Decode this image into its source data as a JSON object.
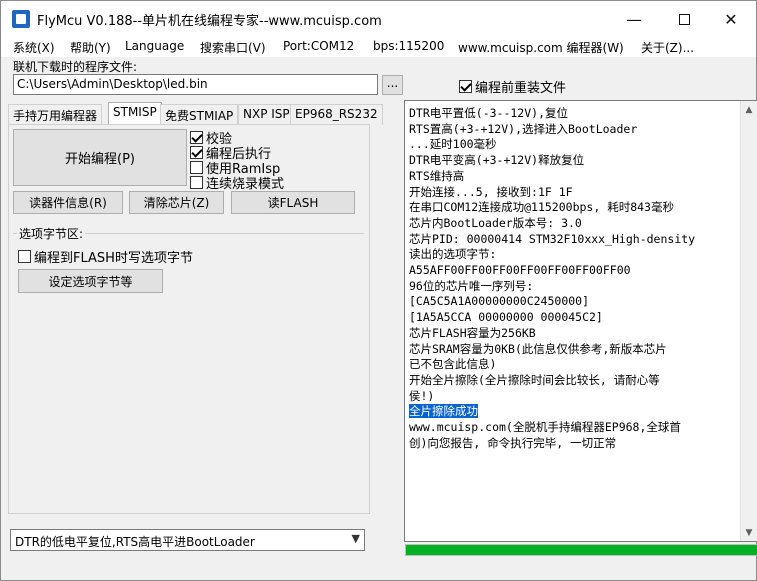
{
  "window": {
    "title": "FlyMcu V0.188--单片机在线编程专家--www.mcuisp.com",
    "minimize_glyph": "—",
    "close_glyph": "✕"
  },
  "menu": {
    "items": [
      "系统(X)",
      "帮助(Y)",
      "Language",
      "搜索串口(V)",
      "Port:COM12",
      "bps:115200",
      "www.mcuisp.com 编程器(W)",
      "关于(Z)..."
    ]
  },
  "file": {
    "label": "联机下载时的程序文件:",
    "path": "C:\\Users\\Admin\\Desktop\\led.bin",
    "browse_label": "...",
    "reload_label": "编程前重装文件",
    "reload_checked": true
  },
  "tabs": [
    "手持万用编程器",
    "STMISP",
    "免费STMIAP",
    "NXP ISP",
    "EP968_RS232"
  ],
  "active_tab": 1,
  "stmisp": {
    "start_label": "开始编程(P)",
    "options": [
      {
        "label": "校验",
        "checked": true
      },
      {
        "label": "编程后执行",
        "checked": true
      },
      {
        "label": "使用RamIsp",
        "checked": false
      },
      {
        "label": "连续烧录模式",
        "checked": false
      }
    ],
    "read_info_label": "读器件信息(R)",
    "erase_label": "清除芯片(Z)",
    "read_flash_label": "读FLASH",
    "option_group_title": "选项字节区:",
    "flash_opt_label": "编程到FLASH时写选项字节",
    "flash_opt_checked": false,
    "set_opt_label": "设定选项字节等"
  },
  "mode_select": {
    "value": "DTR的低电平复位,RTS高电平进BootLoader"
  },
  "log": {
    "lines": [
      "DTR电平置低(-3--12V),复位",
      "RTS置高(+3-+12V),选择进入BootLoader",
      "...延时100毫秒",
      "DTR电平变高(+3-+12V)释放复位",
      "RTS维持高",
      "开始连接...5, 接收到:1F 1F",
      "在串口COM12连接成功@115200bps, 耗时843毫秒",
      "芯片内BootLoader版本号: 3.0",
      "芯片PID: 00000414  STM32F10xxx_High-density",
      "读出的选项字节:",
      "A55AFF00FF00FF00FF00FF00FF00FF00",
      "96位的芯片唯一序列号:",
      "[CA5C5A1A00000000C2450000]",
      "[1A5A5CCA 00000000 000045C2]",
      "芯片FLASH容量为256KB",
      "芯片SRAM容量为0KB(此信息仅供参考,新版本芯片",
      "已不包含此信息)",
      "开始全片擦除(全片擦除时间会比较长, 请耐心等",
      "侯!)",
      "全片擦除成功",
      "www.mcuisp.com(全脱机手持编程器EP968,全球首",
      "创)向您报告, 命令执行完毕, 一切正常"
    ],
    "highlight_index": 19
  },
  "progress": {
    "fraction": 1.0,
    "color": "#06b025"
  }
}
